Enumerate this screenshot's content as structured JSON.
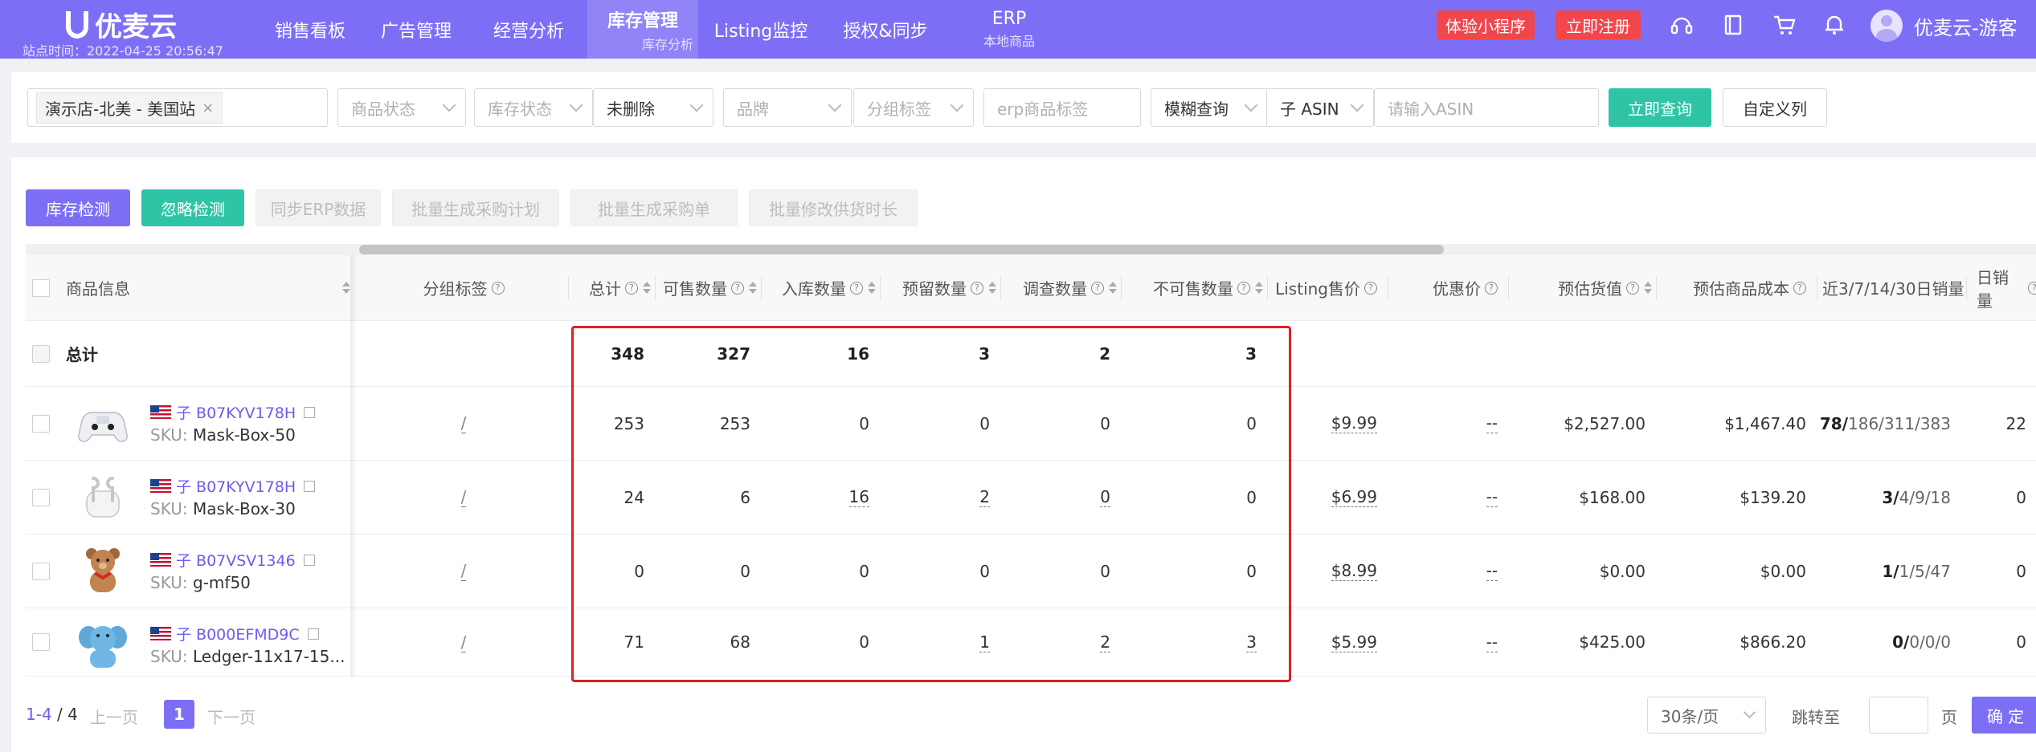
{
  "header": {
    "logo_text": "优麦云",
    "site_time": "站点时间：2022-04-25 20:56:47",
    "nav": [
      {
        "label": "销售看板",
        "sub": ""
      },
      {
        "label": "广告管理",
        "sub": ""
      },
      {
        "label": "经营分析",
        "sub": ""
      },
      {
        "label": "库存管理",
        "sub": "库存分析"
      },
      {
        "label": "Listing监控",
        "sub": ""
      },
      {
        "label": "授权&同步",
        "sub": ""
      },
      {
        "label": "ERP",
        "sub": "本地商品"
      }
    ],
    "trial_label": "体验小程序",
    "register_label": "立即注册",
    "icons": [
      "headset-icon",
      "book-icon",
      "cart-icon",
      "bell-icon"
    ],
    "user_name": "优麦云-游客"
  },
  "filters": {
    "store_tag": "演示店-北美 - 美国站",
    "product_status": "商品状态",
    "stock_status": "库存状态",
    "deleted": "未删除",
    "brand": "品牌",
    "group_tag": "分组标签",
    "erp_tag_placeholder": "erp商品标签",
    "match_mode": "模糊查询",
    "asin_type": "子 ASIN",
    "asin_placeholder": "请输入ASIN",
    "search_label": "立即查询",
    "custom_columns_label": "自定义列"
  },
  "actions": {
    "inventory_check": "库存检测",
    "ignore_check": "忽略检测",
    "sync_erp": "同步ERP数据",
    "batch_plan": "批量生成采购计划",
    "batch_order": "批量生成采购单",
    "batch_lead_time": "批量修改供货时长"
  },
  "table": {
    "headers": {
      "product": "商品信息",
      "group_tag": "分组标签",
      "total": "总计",
      "available": "可售数量",
      "inbound": "入库数量",
      "reserved": "预留数量",
      "researching": "调查数量",
      "unsellable": "不可售数量",
      "listing_price": "Listing售价",
      "discount_price": "优惠价",
      "est_value": "预估货值",
      "est_cost": "预估商品成本",
      "recent_sales": "近3/7/14/30日销量",
      "daily_sales": "日销量"
    },
    "total_row": {
      "label": "总计",
      "total": "348",
      "available": "327",
      "inbound": "16",
      "reserved": "3",
      "researching": "2",
      "unsellable": "3"
    },
    "rows": [
      {
        "asin": "子 B07KYV178H",
        "sku_label": "SKU: ",
        "sku": "Mask-Box-50",
        "group": "/",
        "total": "253",
        "available": "253",
        "inbound": "0",
        "reserved": "0",
        "researching": "0",
        "unsellable": "0",
        "price": "$9.99",
        "discount": "--",
        "value": "$2,527.00",
        "cost": "$1,467.40",
        "s3": "78/",
        "s_rest": "186/311/383",
        "daily": "22",
        "image": "game-controller-image"
      },
      {
        "asin": "子 B07KYV178H",
        "sku_label": "SKU: ",
        "sku": "Mask-Box-30",
        "group": "/",
        "total": "24",
        "available": "6",
        "inbound": "16",
        "reserved": "2",
        "researching": "0",
        "unsellable": "0",
        "price": "$6.99",
        "discount": "--",
        "value": "$168.00",
        "cost": "$139.20",
        "s3": "3/",
        "s_rest": "4/9/18",
        "daily": "0",
        "image": "earbuds-image"
      },
      {
        "asin": "子 B07VSV1346",
        "sku_label": "SKU: ",
        "sku": "g-mf50",
        "group": "/",
        "total": "0",
        "available": "0",
        "inbound": "0",
        "reserved": "0",
        "researching": "0",
        "unsellable": "0",
        "price": "$8.99",
        "discount": "--",
        "value": "$0.00",
        "cost": "$0.00",
        "s3": "1/",
        "s_rest": "1/5/47",
        "daily": "0",
        "image": "teddy-bear-image"
      },
      {
        "asin": "子 B000EFMD9C",
        "sku_label": "SKU: ",
        "sku": "Ledger-11x17-15...",
        "group": "/",
        "total": "71",
        "available": "68",
        "inbound": "0",
        "reserved": "1",
        "researching": "2",
        "unsellable": "3",
        "price": "$5.99",
        "discount": "--",
        "value": "$425.00",
        "cost": "$866.20",
        "s3": "0/",
        "s_rest": "0/0/0",
        "daily": "0",
        "image": "plush-elephant-image"
      }
    ]
  },
  "pagination": {
    "range": "1-4",
    "total": "/ 4",
    "prev": "上一页",
    "current": "1",
    "next": "下一页",
    "page_size": "30条/页",
    "jump_label": "跳转至",
    "page_unit": "页",
    "confirm": "确 定"
  }
}
